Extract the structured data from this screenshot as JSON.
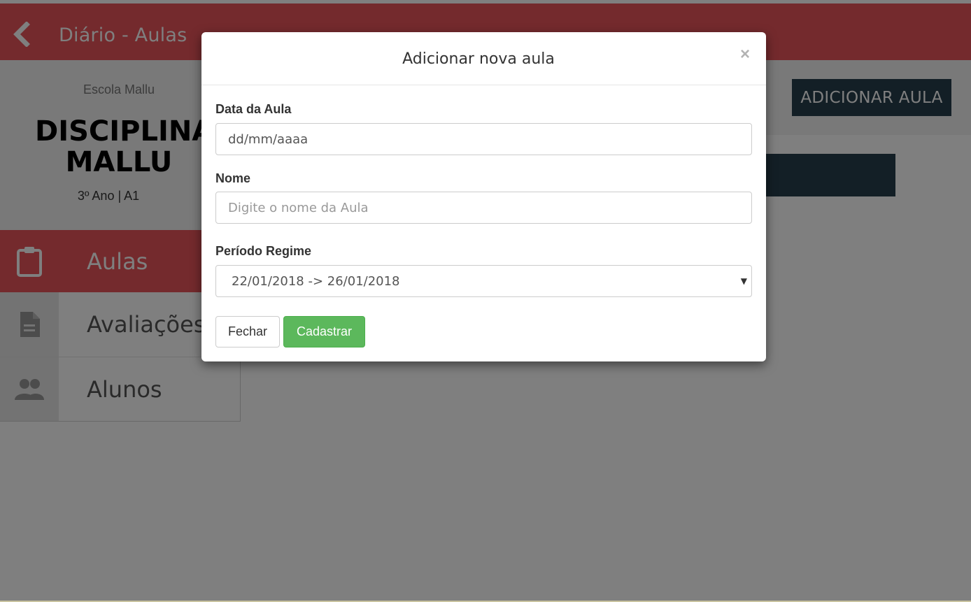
{
  "appbar": {
    "title": "Diário - Aulas",
    "back_icon": "chevron-left-icon",
    "color": "#e8555a"
  },
  "discipline": {
    "school": "Escola Mallu",
    "name": "DISCIPLINA MALLU",
    "class_info": "3º Ano | A1"
  },
  "actions": {
    "add_class_label": "ADICIONAR AULA",
    "color": "#263e4d"
  },
  "nav": {
    "items": [
      {
        "label": "Aulas",
        "icon": "clipboard-icon",
        "active": true
      },
      {
        "label": "Avaliações",
        "icon": "document-icon",
        "active": false
      },
      {
        "label": "Alunos",
        "icon": "people-icon",
        "active": false
      }
    ]
  },
  "modal": {
    "title": "Adicionar nova aula",
    "close_symbol": "×",
    "date_label": "Data da Aula",
    "date_value": "dd/mm/aaaa",
    "name_label": "Nome",
    "name_placeholder": "Digite o nome da Aula",
    "period_label": "Período Regime",
    "period_value": "22/01/2018 -> 26/01/2018",
    "close_button": "Fechar",
    "save_button": "Cadastrar",
    "save_color": "#5cb85c"
  }
}
